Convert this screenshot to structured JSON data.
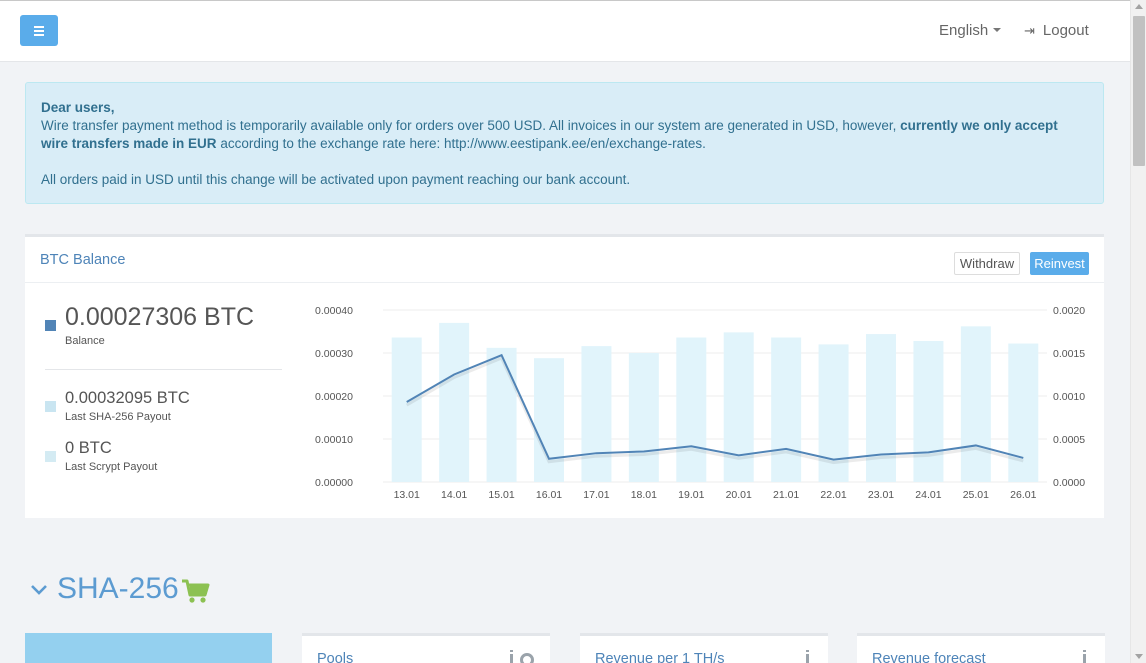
{
  "topbar": {
    "language": "English",
    "logout_label": "Logout"
  },
  "alert": {
    "heading": "Dear users,",
    "line1_start": "Wire transfer payment method is temporarily available only for orders over 500 USD. All invoices in our system are generated in USD, however, ",
    "line1_bold": "currently we only accept wire transfers made in EUR",
    "line1_mid": " according to the exchange rate here: ",
    "link": "http://www.eestipank.ee/en/exchange-rates",
    "line1_end": ".",
    "line2": "All orders paid in USD until this change will be activated upon payment reaching our bank account."
  },
  "balance_panel": {
    "title": "BTC Balance",
    "withdraw_label": "Withdraw",
    "reinvest_label": "Reinvest",
    "balance_value": "0.00027306 BTC",
    "balance_label": "Balance",
    "sha_value": "0.00032095 BTC",
    "sha_label": "Last SHA-256 Payout",
    "scrypt_value": "0 BTC",
    "scrypt_label": "Last Scrypt Payout",
    "colors": {
      "balance": "#5184b6",
      "sha": "#c9e5f1",
      "scrypt": "#d4ebf3"
    }
  },
  "chart_data": {
    "type": "bar",
    "categories": [
      "13.01",
      "14.01",
      "15.01",
      "16.01",
      "17.01",
      "18.01",
      "19.01",
      "20.01",
      "21.01",
      "22.01",
      "23.01",
      "24.01",
      "25.01",
      "26.01"
    ],
    "series": [
      {
        "name": "Last SHA-256 Payout",
        "type": "bar",
        "axis": "right",
        "color": "#e1f4fb",
        "values": [
          0.00168,
          0.00185,
          0.00156,
          0.00144,
          0.00158,
          0.0015,
          0.00168,
          0.00174,
          0.00168,
          0.0016,
          0.00172,
          0.00164,
          0.00181,
          0.00161
        ]
      },
      {
        "name": "Balance",
        "type": "line",
        "axis": "left",
        "color": "#5184b6",
        "values": [
          0.000186,
          0.00025,
          0.000295,
          5.4e-05,
          6.7e-05,
          7.1e-05,
          8.3e-05,
          6.2e-05,
          7.7e-05,
          5.2e-05,
          6.4e-05,
          6.9e-05,
          8.5e-05,
          5.6e-05
        ]
      }
    ],
    "y_left": {
      "ticks": [
        "0.00000",
        "0.00010",
        "0.00020",
        "0.00030",
        "0.00040"
      ],
      "range": [
        0,
        0.0004
      ]
    },
    "y_right": {
      "ticks": [
        "0.0000",
        "0.0005",
        "0.0010",
        "0.0015",
        "0.0020"
      ],
      "range": [
        0,
        0.002
      ]
    },
    "grid": true,
    "legend": "none"
  },
  "section": {
    "title": "SHA-256"
  },
  "cards": {
    "pools": "Pools",
    "revenue": "Revenue per 1 TH/s",
    "forecast": "Revenue forecast"
  }
}
